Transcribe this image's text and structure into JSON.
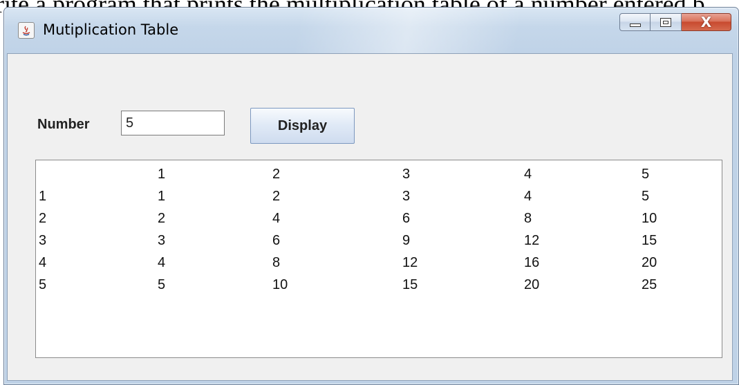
{
  "background_text": "rite a program that prints the multiplication table of a number entered b",
  "window": {
    "title": "Mutiplication Table",
    "close_glyph": "X"
  },
  "form": {
    "number_label": "Number",
    "number_value": "5",
    "display_button": "Display"
  },
  "table": {
    "header": [
      "",
      "1",
      "2",
      "3",
      "4",
      "5"
    ],
    "rows": [
      [
        "1",
        "1",
        "2",
        "3",
        "4",
        "5"
      ],
      [
        "2",
        "2",
        "4",
        "6",
        "8",
        "10"
      ],
      [
        "3",
        "3",
        "6",
        "9",
        "12",
        "15"
      ],
      [
        "4",
        "4",
        "8",
        "12",
        "16",
        "20"
      ],
      [
        "5",
        "5",
        "10",
        "15",
        "20",
        "25"
      ]
    ]
  }
}
